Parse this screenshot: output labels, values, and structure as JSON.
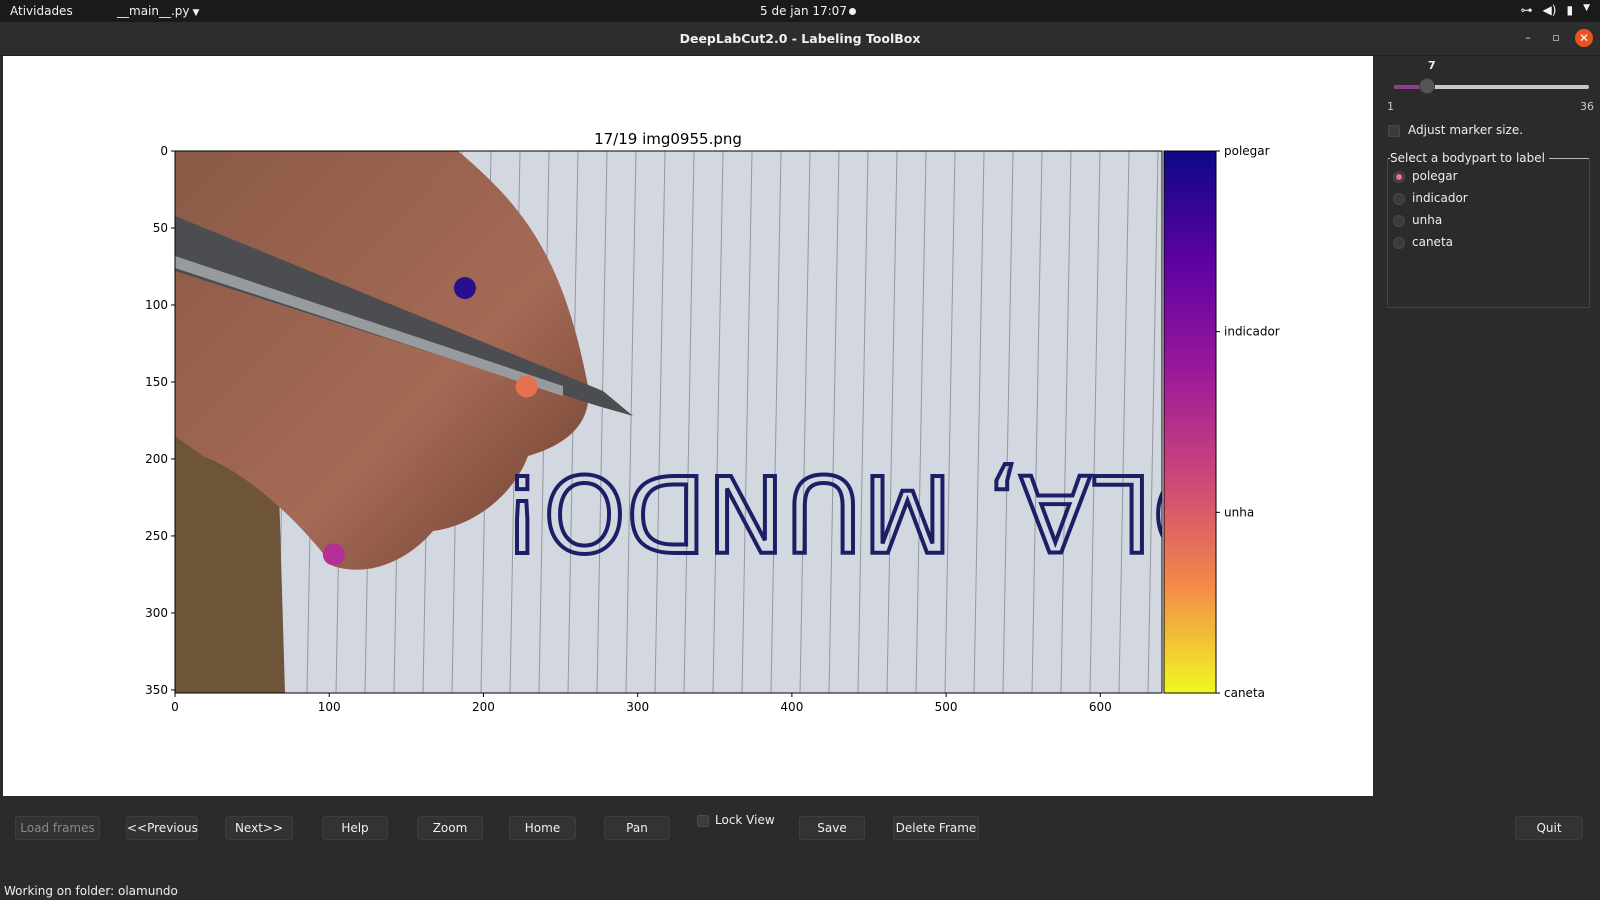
{
  "topbar": {
    "activities": "Atividades",
    "app_menu": "__main__.py",
    "clock": "5 de jan  17:07"
  },
  "window": {
    "title": "DeepLabCut2.0 - Labeling ToolBox"
  },
  "figure": {
    "title": "17/19 img0955.png",
    "x_ticks": [
      "0",
      "100",
      "200",
      "300",
      "400",
      "500",
      "600"
    ],
    "y_ticks": [
      "0",
      "50",
      "100",
      "150",
      "200",
      "250",
      "300",
      "350"
    ],
    "image_extent": {
      "x": [
        0,
        640
      ],
      "y": [
        0,
        352
      ]
    },
    "colorbar_labels": [
      "polegar",
      "indicador",
      "unha",
      "caneta"
    ],
    "colorbar_colormap": [
      "#0d0887",
      "#6a00a8",
      "#b12a90",
      "#e16462",
      "#fca636",
      "#f0f921"
    ],
    "markers": [
      {
        "bodypart": "polegar",
        "x": 188,
        "y": 89,
        "color": "#2a0f8c"
      },
      {
        "bodypart": "unha",
        "x": 228,
        "y": 153,
        "color": "#e5714f"
      },
      {
        "bodypart": "indicador",
        "x": 103,
        "y": 262,
        "color": "#b42f96"
      }
    ],
    "photo_text": "OLA, MUNDO!"
  },
  "sidepanel": {
    "slider_value": "7",
    "slider_min": "1",
    "slider_max": "36",
    "slider_level": 0.17,
    "adjust_marker_label": "Adjust marker size.",
    "bodypart_group_label": "Select a bodypart to label",
    "bodyparts": [
      "polegar",
      "indicador",
      "unha",
      "caneta"
    ],
    "selected_bodypart": "polegar"
  },
  "toolbar": {
    "load_frames": "Load frames",
    "previous": "<<Previous",
    "next": "Next>>",
    "help": "Help",
    "zoom": "Zoom",
    "home": "Home",
    "pan": "Pan",
    "lock_view": "Lock View",
    "save": "Save",
    "delete_frame": "Delete Frame",
    "quit": "Quit"
  },
  "status": {
    "text": "Working on folder: olamundo"
  },
  "colors": {
    "accent": "#e95420",
    "slider_fill": "#8c3f8f",
    "radio_selected": "#e96aa8"
  }
}
